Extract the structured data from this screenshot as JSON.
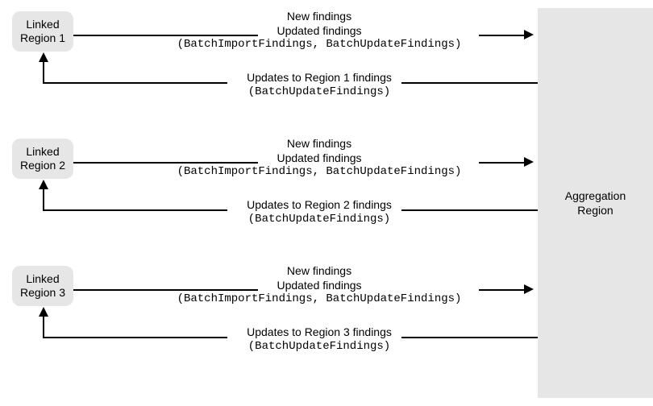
{
  "linked_regions": [
    {
      "label_line1": "Linked",
      "label_line2": "Region 1",
      "forward_line1": "New findings",
      "forward_line2": "Updated findings",
      "forward_apis": "(BatchImportFindings, BatchUpdateFindings)",
      "return_line": "Updates to Region 1 findings",
      "return_apis": "(BatchUpdateFindings)"
    },
    {
      "label_line1": "Linked",
      "label_line2": "Region 2",
      "forward_line1": "New findings",
      "forward_line2": "Updated findings",
      "forward_apis": "(BatchImportFindings, BatchUpdateFindings)",
      "return_line": "Updates to Region 2 findings",
      "return_apis": "(BatchUpdateFindings)"
    },
    {
      "label_line1": "Linked",
      "label_line2": "Region 3",
      "forward_line1": "New findings",
      "forward_line2": "Updated findings",
      "forward_apis": "(BatchImportFindings, BatchUpdateFindings)",
      "return_line": "Updates to Region 3 findings",
      "return_apis": "(BatchUpdateFindings)"
    }
  ],
  "aggregation_label_line1": "Aggregation",
  "aggregation_label_line2": "Region"
}
